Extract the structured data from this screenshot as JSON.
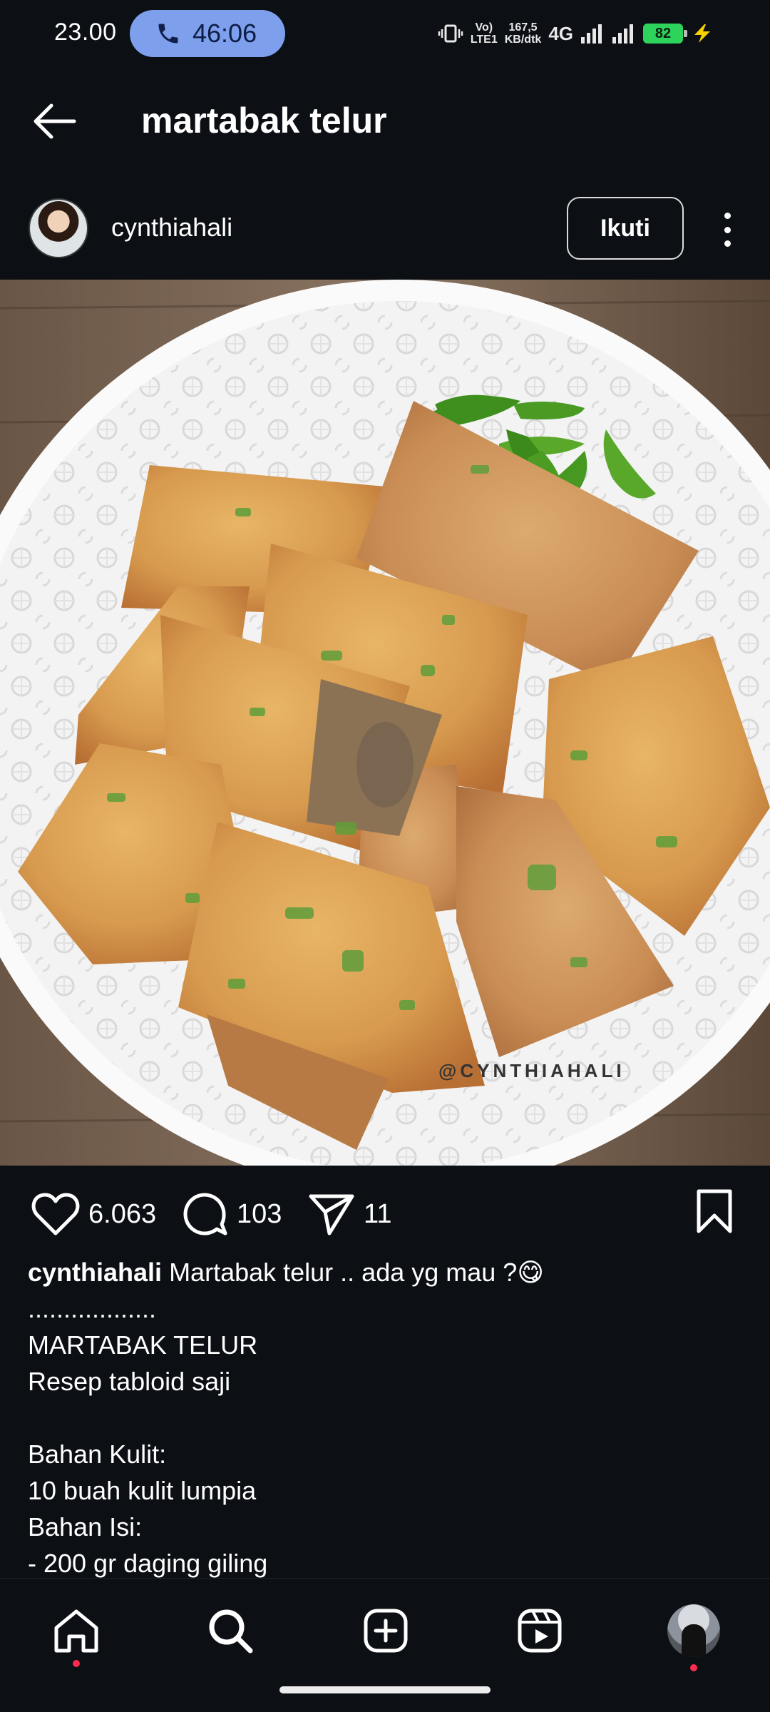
{
  "status_bar": {
    "time": "23.00",
    "call_duration": "46:06",
    "volte_top": "Vo)",
    "volte_bottom": "LTE1",
    "speed_top": "167,5",
    "speed_bottom": "KB/dtk",
    "network": "4G",
    "battery": "82",
    "accent_call": "#7ea0ec",
    "accent_battery": "#2dd35b"
  },
  "header": {
    "title": "martabak telur",
    "back_icon": "arrow-left-icon"
  },
  "author": {
    "username": "cynthiahali",
    "follow_label": "Ikuti"
  },
  "post": {
    "watermark": "@CYNTHIAHALI",
    "likes": "6.063",
    "comments": "103",
    "shares": "11"
  },
  "caption": {
    "username": "cynthiahali",
    "first_line": " Martabak telur .. ada yg mau ?😋",
    "lines": [
      "..................",
      "MARTABAK TELUR",
      "Resep tabloid saji",
      "",
      "Bahan Kulit:",
      "10 buah kulit lumpia",
      "Bahan Isi:",
      "- 200 gr daging giling"
    ]
  },
  "bottom_nav": {
    "items": [
      "home-icon",
      "search-icon",
      "create-icon",
      "reels-icon",
      "profile-avatar"
    ],
    "notification_color": "#ff2b4f"
  }
}
